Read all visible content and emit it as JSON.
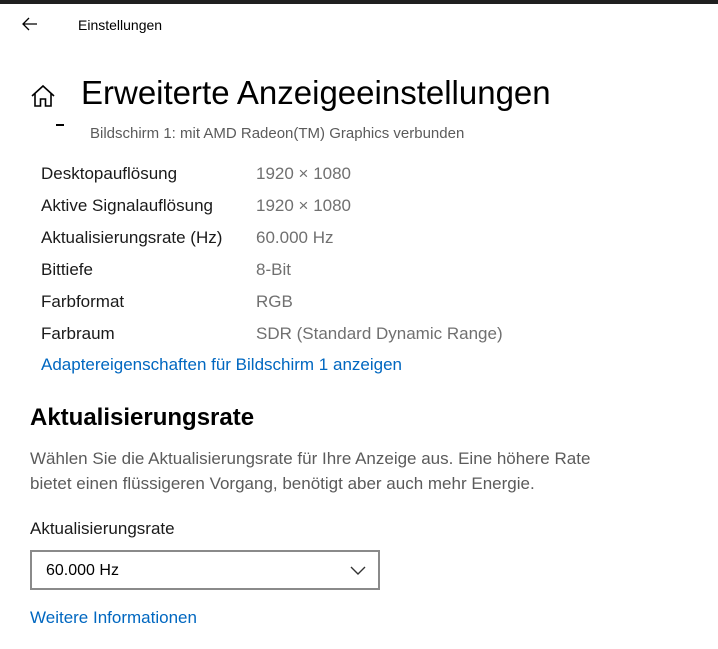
{
  "window": {
    "title": "Einstellungen",
    "back_icon": "arrow-left"
  },
  "header": {
    "icon": "home",
    "title": "Erweiterte Anzeigeeinstellungen"
  },
  "monitor": {
    "subtitle": "Bildschirm 1: mit AMD Radeon(TM) Graphics verbunden"
  },
  "display_info": {
    "rows": [
      {
        "label": "Desktopauflösung",
        "value": "1920 × 1080"
      },
      {
        "label": "Aktive Signalauflösung",
        "value": "1920 × 1080"
      },
      {
        "label": "Aktualisierungsrate (Hz)",
        "value": "60.000 Hz"
      },
      {
        "label": "Bittiefe",
        "value": "8-Bit"
      },
      {
        "label": "Farbformat",
        "value": "RGB"
      },
      {
        "label": "Farbraum",
        "value": "SDR (Standard Dynamic Range)"
      }
    ],
    "adapter_link": "Adaptereigenschaften für Bildschirm 1 anzeigen"
  },
  "refresh_rate": {
    "heading": "Aktualisierungsrate",
    "description": "Wählen Sie die Aktualisierungsrate für Ihre Anzeige aus. Eine höhere Rate bietet einen flüssigeren Vorgang, benötigt aber auch mehr Energie.",
    "dropdown_label": "Aktualisierungsrate",
    "selected": "60.000 Hz",
    "more_info_link": "Weitere Informationen"
  },
  "colors": {
    "link": "#0067c0",
    "secondary_text": "#5b5b5b",
    "value_text": "#707070",
    "border": "#8a8a8a"
  }
}
